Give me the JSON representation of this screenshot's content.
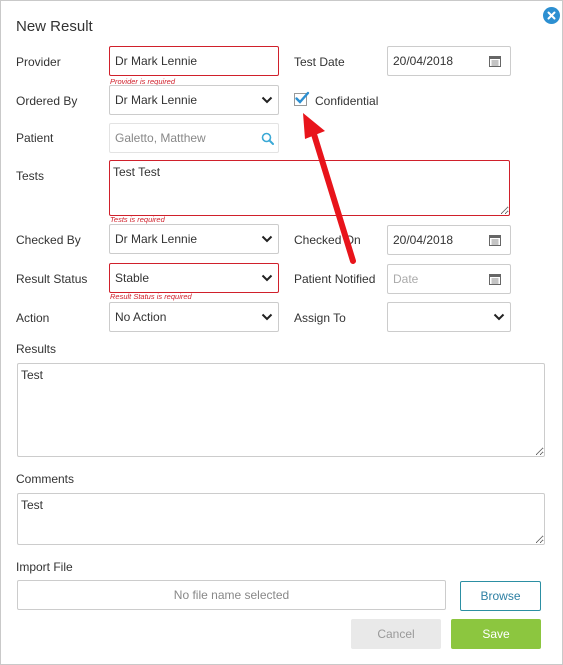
{
  "dialog": {
    "title": "New Result"
  },
  "form": {
    "provider": {
      "label": "Provider",
      "value": "Dr Mark Lennie",
      "error": "Provider is required"
    },
    "test_date": {
      "label": "Test Date",
      "value": "20/04/2018"
    },
    "ordered_by": {
      "label": "Ordered By",
      "value": "Dr Mark Lennie"
    },
    "confidential": {
      "label": "Confidential",
      "checked": true
    },
    "patient": {
      "label": "Patient",
      "value": "Galetto, Matthew"
    },
    "tests": {
      "label": "Tests",
      "value": "Test Test",
      "error": "Tests is required"
    },
    "checked_by": {
      "label": "Checked By",
      "value": "Dr Mark Lennie"
    },
    "checked_on": {
      "label": "Checked On",
      "value": "20/04/2018"
    },
    "result_status": {
      "label": "Result Status",
      "value": "Stable",
      "error": "Result Status is required"
    },
    "patient_notified": {
      "label": "Patient Notified",
      "placeholder": "Date"
    },
    "action": {
      "label": "Action",
      "value": "No Action"
    },
    "assign_to": {
      "label": "Assign To",
      "value": ""
    },
    "results": {
      "label": "Results",
      "value": "Test"
    },
    "comments": {
      "label": "Comments",
      "value": "Test"
    },
    "import_file": {
      "label": "Import File",
      "placeholder": "No file name selected",
      "browse_label": "Browse"
    }
  },
  "buttons": {
    "cancel_label": "Cancel",
    "save_label": "Save"
  },
  "icons": {
    "close": "close-icon",
    "calendar": "calendar-icon",
    "caret": "chevron-down-icon",
    "search": "search-icon",
    "check": "checkmark-icon"
  },
  "colors": {
    "accent": "#2c8fd1",
    "error": "#d0202b",
    "save": "#8cc63f",
    "cancel_bg": "#e9e9e9",
    "annotation_arrow": "#e8141b"
  }
}
